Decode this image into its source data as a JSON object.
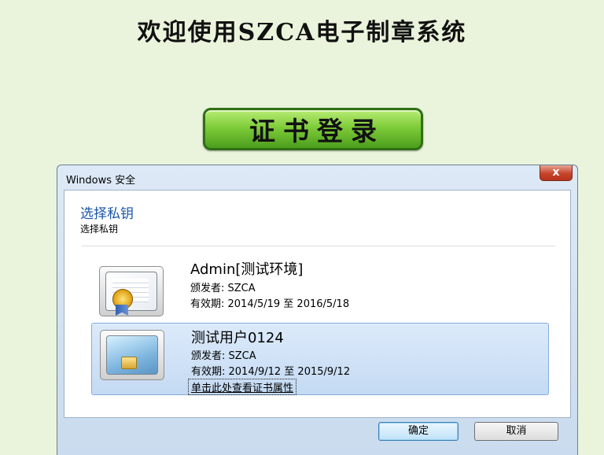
{
  "page": {
    "title": "欢迎使用SZCA电子制章系统"
  },
  "login_button": {
    "label": "证书登录"
  },
  "dialog": {
    "title": "Windows 安全",
    "close_label": "x",
    "heading": "选择私钥",
    "subheading": "选择私钥",
    "certificates": [
      {
        "name": "Admin[测试环境]",
        "issuer": "颁发者: SZCA",
        "validity": "有效期: 2014/5/19 至 2016/5/18",
        "icon": "certificate-document-icon",
        "selected": false
      },
      {
        "name": "测试用户0124",
        "issuer": "颁发者: SZCA",
        "validity": "有效期: 2014/9/12 至 2015/9/12",
        "icon": "smart-card-icon",
        "selected": true,
        "link": "单击此处查看证书属性"
      }
    ],
    "ok_label": "确定",
    "cancel_label": "取消"
  },
  "colors": {
    "page_background": "#eaf4dc",
    "button_green": "#7fcc39",
    "heading_blue": "#1a55a6",
    "selection_blue": "#c4daf3",
    "close_red": "#c7442a"
  }
}
